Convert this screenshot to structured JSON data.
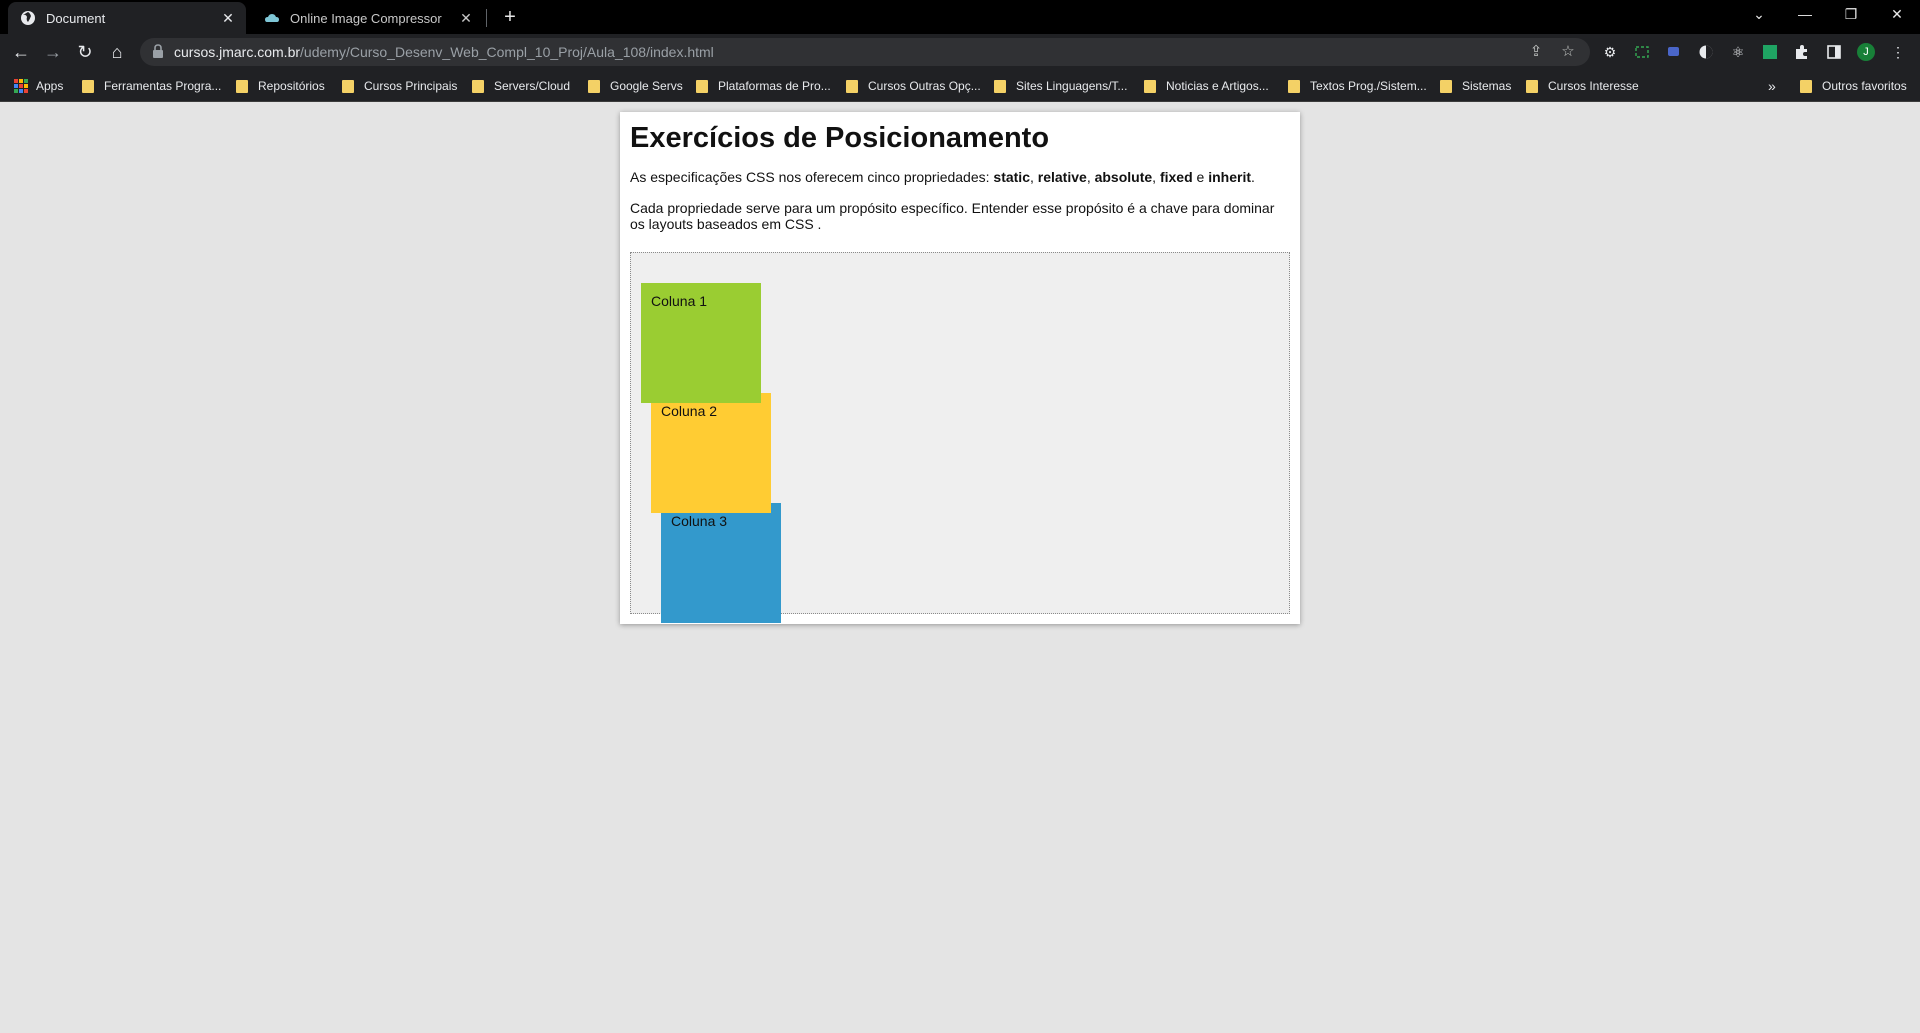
{
  "browser": {
    "tabs": [
      {
        "title": "Document",
        "close": "✕"
      },
      {
        "title": "Online Image Compressor",
        "close": "✕"
      }
    ],
    "new_tab": "+",
    "window_controls": {
      "tab_search": "⌄",
      "minimize": "—",
      "restore": "❐",
      "close": "✕"
    },
    "nav": {
      "back": "←",
      "forward": "→",
      "reload": "↻",
      "home": "⌂"
    },
    "url_host": "cursos.jmarc.com.br",
    "url_path": "/udemy/Curso_Desenv_Web_Compl_10_Proj/Aula_108/index.html",
    "omnibox_icons": {
      "share": "⇪",
      "bookmark_star": "☆"
    },
    "profile_initial": "J",
    "bookmarks": [
      "Apps",
      "Ferramentas Progra...",
      "Repositórios",
      "Cursos Principais",
      "Servers/Cloud",
      "Google Servs",
      "Plataformas de Pro...",
      "Cursos Outras Opç...",
      "Sites Linguagens/T...",
      "Noticias e Artigos...",
      "Textos Prog./Sistem...",
      "Sistemas",
      "Cursos Interesse"
    ],
    "bookmarks_overflow": "»",
    "other_bookmarks": "Outros favoritos",
    "colors": {
      "tab_active_bg": "#202124",
      "toolbar_bg": "#202124",
      "folder": "#f4d166",
      "profile": "#188038"
    }
  },
  "page": {
    "heading": "Exercícios de Posicionamento",
    "intro": {
      "prefix": "As especificações CSS nos oferecem cinco propriedades: ",
      "props": [
        "static",
        "relative",
        "absolute",
        "fixed",
        "inherit"
      ],
      "sep1": ", ",
      "sep2": ", ",
      "sep3": ", ",
      "sep4": " e ",
      "end": "."
    },
    "paragraph2": "Cada propriedade serve para um propósito específico. Entender esse propósito é a chave para dominar os layouts baseados em CSS .",
    "columns": [
      {
        "label": "Coluna 1",
        "color": "#9acd32"
      },
      {
        "label": "Coluna 2",
        "color": "#ffcc33"
      },
      {
        "label": "Coluna 3",
        "color": "#3399cc"
      }
    ]
  }
}
